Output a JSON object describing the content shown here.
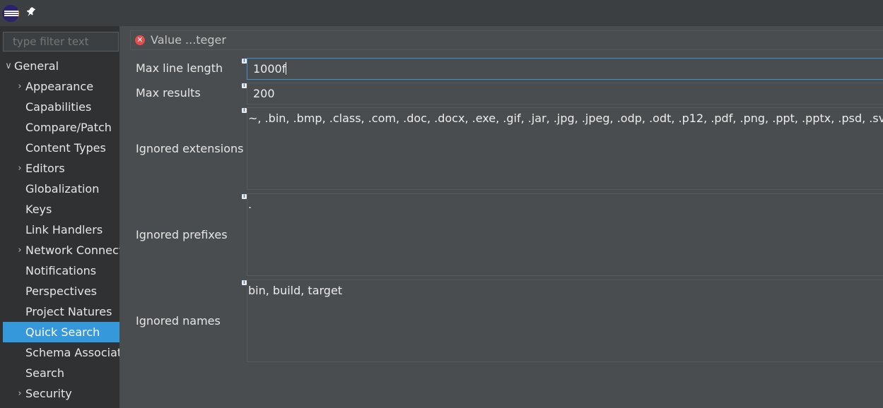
{
  "titlebar": {
    "logo_icon": "eclipse-logo-icon",
    "pin_icon": "pin-icon"
  },
  "sidebar": {
    "filter_placeholder": "type filter text",
    "items": [
      {
        "label": "General",
        "expandable": true,
        "expanded": true,
        "level": 0,
        "selected": false
      },
      {
        "label": "Appearance",
        "expandable": true,
        "expanded": false,
        "level": 1,
        "selected": false
      },
      {
        "label": "Capabilities",
        "expandable": false,
        "level": 1,
        "selected": false
      },
      {
        "label": "Compare/Patch",
        "expandable": false,
        "level": 1,
        "selected": false
      },
      {
        "label": "Content Types",
        "expandable": false,
        "level": 1,
        "selected": false
      },
      {
        "label": "Editors",
        "expandable": true,
        "expanded": false,
        "level": 1,
        "selected": false
      },
      {
        "label": "Globalization",
        "expandable": false,
        "level": 1,
        "selected": false
      },
      {
        "label": "Keys",
        "expandable": false,
        "level": 1,
        "selected": false
      },
      {
        "label": "Link Handlers",
        "expandable": false,
        "level": 1,
        "selected": false
      },
      {
        "label": "Network Connect",
        "expandable": true,
        "expanded": false,
        "level": 1,
        "selected": false
      },
      {
        "label": "Notifications",
        "expandable": false,
        "level": 1,
        "selected": false
      },
      {
        "label": "Perspectives",
        "expandable": false,
        "level": 1,
        "selected": false
      },
      {
        "label": "Project Natures",
        "expandable": false,
        "level": 1,
        "selected": false
      },
      {
        "label": "Quick Search",
        "expandable": false,
        "level": 1,
        "selected": true
      },
      {
        "label": "Schema Associati",
        "expandable": false,
        "level": 1,
        "selected": false
      },
      {
        "label": "Search",
        "expandable": false,
        "level": 1,
        "selected": false
      },
      {
        "label": "Security",
        "expandable": true,
        "expanded": false,
        "level": 1,
        "selected": false
      }
    ]
  },
  "main": {
    "header": {
      "icon": "error-icon",
      "message": "Value ...teger"
    },
    "fields": {
      "max_line_length": {
        "label": "Max line length",
        "value": "1000f"
      },
      "max_results": {
        "label": "Max results",
        "value": "200"
      },
      "ignored_extensions": {
        "label": "Ignored extensions",
        "value": "~, .bin, .bmp, .class, .com, .doc, .docx, .exe, .gif, .jar, .jpg, .jpeg, .odp, .odt, .p12, .pdf, .png, .ppt, .pptx, .psd, .svg, .xls, .xlsx,"
      },
      "ignored_prefixes": {
        "label": "Ignored prefixes",
        "value": "."
      },
      "ignored_names": {
        "label": "Ignored names",
        "value": "bin, build, target"
      }
    }
  },
  "colors": {
    "selection": "#3498db",
    "focus_border": "#3c8fd0",
    "error": "#e64c4c",
    "sidebar_bg": "#2f3133",
    "main_bg": "#4a4d50"
  }
}
